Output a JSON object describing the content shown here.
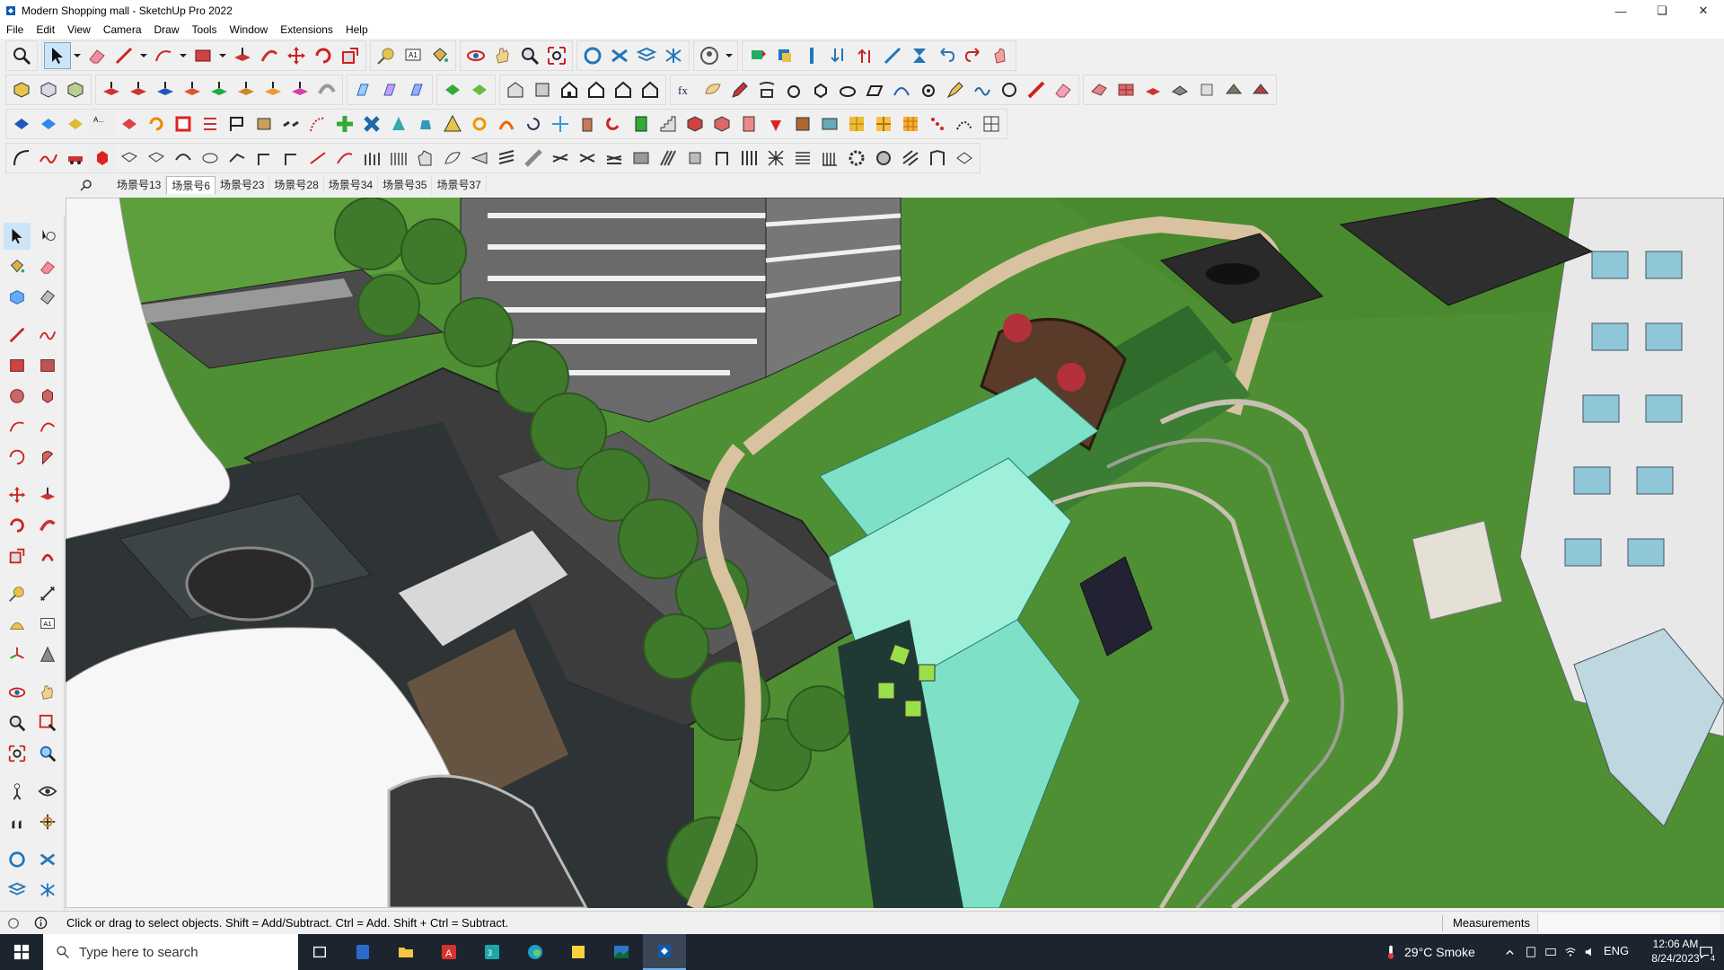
{
  "window": {
    "title": "Modern Shopping mall - SketchUp Pro 2022"
  },
  "menu": [
    "File",
    "Edit",
    "View",
    "Camera",
    "Draw",
    "Tools",
    "Window",
    "Extensions",
    "Help"
  ],
  "scenes": {
    "tabs": [
      "场景号13",
      "场景号6",
      "场景号23",
      "场景号28",
      "场景号34",
      "场景号35",
      "场景号37"
    ],
    "active_index": 1
  },
  "statusbar": {
    "hint": "Click or drag to select objects. Shift = Add/Subtract. Ctrl = Add. Shift + Ctrl = Subtract.",
    "measurements_label": "Measurements",
    "measurements_value": ""
  },
  "taskbar": {
    "search_placeholder": "Type here to search",
    "weather": "29°C  Smoke",
    "language": "ENG",
    "time": "12:06 AM",
    "date": "8/24/2023",
    "notification_count": "4"
  },
  "colors": {
    "accent": "#0078d4",
    "grass": "#4f8f34",
    "path": "#d9c2a0",
    "water": "#7fe0c8",
    "roof": "#5a5a5a"
  }
}
